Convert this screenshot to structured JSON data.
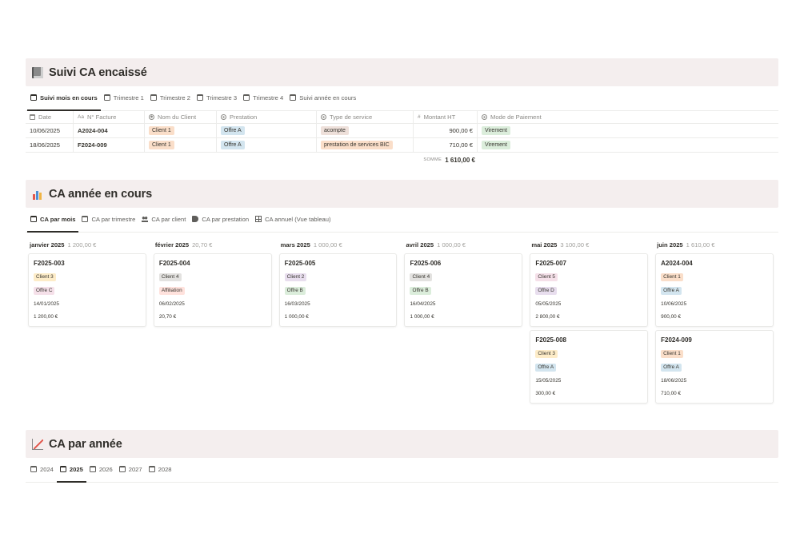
{
  "colors": {
    "header_bg": "#f4eeee",
    "tag_orange": "#fadec9",
    "tag_blue": "#d3e5ef",
    "tag_brown": "#eee0da",
    "tag_green": "#dbeddb",
    "tag_yellow": "#fdecc8",
    "tag_gray": "#e3e2e0",
    "tag_purple": "#e8deee",
    "tag_pink": "#f5e0e9",
    "tag_red": "#ffe2dd"
  },
  "section1": {
    "icon": "ledger-icon",
    "title": "Suivi CA encaissé",
    "tabs": [
      "Suivi mois en cours",
      "Trimestre 1",
      "Trimestre 2",
      "Trimestre 3",
      "Trimestre 4",
      "Suivi année en cours"
    ],
    "table": {
      "headers": {
        "date": "Date",
        "facture": "N° Facture",
        "facture_prefix": "Aa",
        "client": "Nom du Client",
        "prestation": "Prestation",
        "type": "Type de service",
        "montant": "Montant HT",
        "montant_prefix": "#",
        "mode": "Mode de Paiement"
      },
      "rows": [
        {
          "date": "10/06/2025",
          "facture": "A2024-004",
          "client": "Client 1",
          "prestation": "Offre A",
          "type": "acompte",
          "montant": "900,00 €",
          "mode": "Virement"
        },
        {
          "date": "18/06/2025",
          "facture": "F2024-009",
          "client": "Client 1",
          "prestation": "Offre A",
          "type": "prestation de services BIC",
          "montant": "710,00 €",
          "mode": "Virement"
        }
      ],
      "sum_label": "SOMME",
      "sum_value": "1 610,00 €"
    }
  },
  "section2": {
    "icon": "bar-chart-icon",
    "title": "CA année en cours",
    "tabs": [
      "CA par mois",
      "CA par trimestre",
      "CA par client",
      "CA par prestation",
      "CA annuel (Vue tableau)"
    ],
    "columns": [
      {
        "month": "janvier 2025",
        "sum": "1 200,00 €",
        "cards": [
          {
            "title": "F2025-003",
            "client": "Client 3",
            "client_color": "tag_yellow",
            "offer": "Offre C",
            "offer_color": "tag_pink",
            "date": "14/01/2025",
            "amount": "1 200,00 €"
          }
        ]
      },
      {
        "month": "février 2025",
        "sum": "20,70 €",
        "cards": [
          {
            "title": "F2025-004",
            "client": "Client 4",
            "client_color": "tag_gray",
            "offer": "Affiliation",
            "offer_color": "tag_red",
            "date": "06/02/2025",
            "amount": "20,70 €"
          }
        ]
      },
      {
        "month": "mars 2025",
        "sum": "1 000,00 €",
        "cards": [
          {
            "title": "F2025-005",
            "client": "Client 2",
            "client_color": "tag_purple",
            "offer": "Offre B",
            "offer_color": "tag_green",
            "date": "16/03/2025",
            "amount": "1 000,00 €"
          }
        ]
      },
      {
        "month": "avril 2025",
        "sum": "1 000,00 €",
        "cards": [
          {
            "title": "F2025-006",
            "client": "Client 4",
            "client_color": "tag_gray",
            "offer": "Offre B",
            "offer_color": "tag_green",
            "date": "16/04/2025",
            "amount": "1 000,00 €"
          }
        ]
      },
      {
        "month": "mai 2025",
        "sum": "3 100,00 €",
        "cards": [
          {
            "title": "F2025-007",
            "client": "Client 5",
            "client_color": "tag_pink",
            "offer": "Offre D",
            "offer_color": "tag_purple",
            "date": "05/05/2025",
            "amount": "2 800,00 €"
          },
          {
            "title": "F2025-008",
            "client": "Client 3",
            "client_color": "tag_yellow",
            "offer": "Offre A",
            "offer_color": "tag_blue",
            "date": "15/05/2025",
            "amount": "300,00 €"
          }
        ]
      },
      {
        "month": "juin 2025",
        "sum": "1 610,00 €",
        "cards": [
          {
            "title": "A2024-004",
            "client": "Client 1",
            "client_color": "tag_orange",
            "offer": "Offre A",
            "offer_color": "tag_blue",
            "date": "10/06/2025",
            "amount": "900,00 €"
          },
          {
            "title": "F2024-009",
            "client": "Client 1",
            "client_color": "tag_orange",
            "offer": "Offre A",
            "offer_color": "tag_blue",
            "date": "18/06/2025",
            "amount": "710,00 €"
          }
        ]
      }
    ]
  },
  "section3": {
    "icon": "trend-chart-icon",
    "title": "CA par année",
    "tabs": [
      "2024",
      "2025",
      "2026",
      "2027",
      "2028"
    ]
  }
}
